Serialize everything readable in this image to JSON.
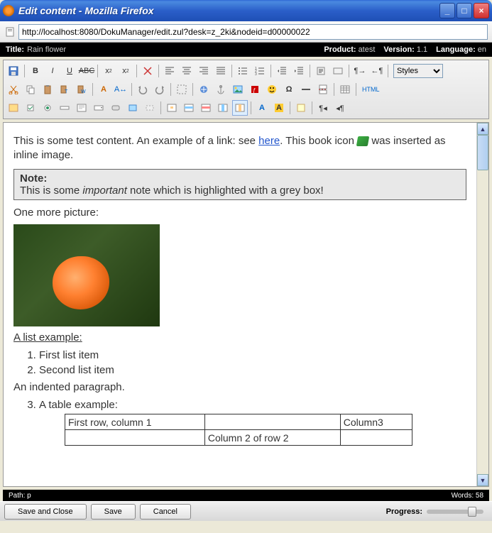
{
  "window": {
    "title": "Edit content - Mozilla Firefox"
  },
  "address": {
    "url": "http://localhost:8080/DokuManager/edit.zul?desk=z_2ki&nodeid=d00000022"
  },
  "meta": {
    "title_label": "Title:",
    "title_value": "Rain flower",
    "product_label": "Product:",
    "product_value": "atest",
    "version_label": "Version:",
    "version_value": "1.1",
    "language_label": "Language:",
    "language_value": "en"
  },
  "toolbar": {
    "styles_label": "Styles",
    "row1": [
      "save",
      "bold",
      "italic",
      "underline",
      "strike",
      "subscript",
      "superscript",
      "clear-format",
      "align-left",
      "align-center",
      "align-right",
      "align-justify",
      "list-bullet",
      "list-number",
      "outdent",
      "indent",
      "blockquote",
      "div",
      "para-ltr",
      "para-rtl"
    ],
    "row2": [
      "cut",
      "copy",
      "paste",
      "paste-text",
      "paste-word",
      "find",
      "replace",
      "undo",
      "redo",
      "select-all",
      "link",
      "anchor",
      "image",
      "flash",
      "smiley",
      "special-char",
      "hr",
      "pagebreak",
      "table",
      "source"
    ],
    "row3": [
      "form",
      "checkbox",
      "radio",
      "textfield",
      "textarea",
      "select",
      "button",
      "imagebutton",
      "hidden",
      "cell-props",
      "row-insert",
      "row-delete",
      "col-insert",
      "col-delete",
      "text-color",
      "bg-color",
      "templates",
      "show-blocks",
      "about"
    ]
  },
  "content": {
    "p1_a": "This is some test content. An example of a link: see ",
    "p1_link": "here",
    "p1_b": ". This book icon ",
    "p1_c": " was inserted as inline image.",
    "note_title": "Note:",
    "note_a": "This is some ",
    "note_em": "important",
    "note_b": " note which is highlighted with a grey box!",
    "p2": "One more picture:",
    "list_heading": "A list example:",
    "li1": "First list item",
    "li2": "Second list item",
    "indent_p": "An indented paragraph.",
    "li3": "A table example:",
    "table": {
      "r1c1": "First row, column 1",
      "r1c2": "",
      "r1c3": "Column3",
      "r2c1": "",
      "r2c2": "Column 2 of row 2",
      "r2c3": ""
    }
  },
  "status": {
    "path": "Path: p",
    "words": "Words: 58"
  },
  "buttons": {
    "save_close": "Save and Close",
    "save": "Save",
    "cancel": "Cancel",
    "progress": "Progress:"
  }
}
